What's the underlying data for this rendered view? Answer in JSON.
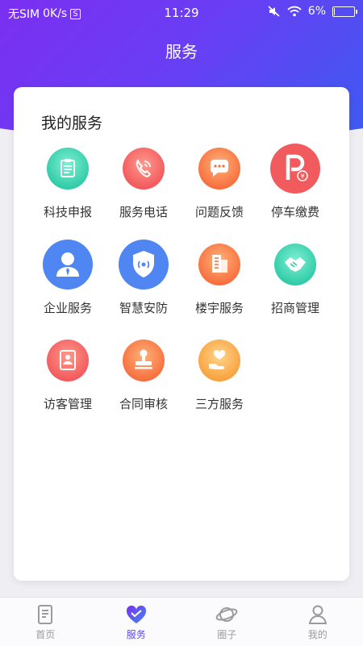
{
  "status_bar": {
    "carrier": "无SIM",
    "speed": "0K/s",
    "s_badge": "S",
    "time": "11:29",
    "battery_text": "6%",
    "battery_level": 0.06
  },
  "header": {
    "title": "服务"
  },
  "card": {
    "title": "我的服务",
    "items": [
      {
        "label": "科技申报",
        "icon": "clipboard-icon"
      },
      {
        "label": "服务电话",
        "icon": "phone-icon"
      },
      {
        "label": "问题反馈",
        "icon": "chat-bubble-icon"
      },
      {
        "label": "停车缴费",
        "icon": "parking-icon"
      },
      {
        "label": "企业服务",
        "icon": "person-icon"
      },
      {
        "label": "智慧安防",
        "icon": "shield-icon"
      },
      {
        "label": "楼宇服务",
        "icon": "building-icon"
      },
      {
        "label": "招商管理",
        "icon": "handshake-icon"
      },
      {
        "label": "访客管理",
        "icon": "visitor-badge-icon"
      },
      {
        "label": "合同审核",
        "icon": "stamp-icon"
      },
      {
        "label": "三方服务",
        "icon": "heart-hand-icon"
      }
    ]
  },
  "tabbar": {
    "tabs": [
      {
        "label": "首页",
        "icon": "home-doc-icon"
      },
      {
        "label": "服务",
        "icon": "heart-service-icon"
      },
      {
        "label": "圈子",
        "icon": "planet-icon"
      },
      {
        "label": "我的",
        "icon": "profile-icon"
      }
    ],
    "active_index": 1
  },
  "colors": {
    "header_gradient_start": "#7b2ff0",
    "header_gradient_end": "#3d5bf0",
    "active_tab": "#5b4bf0"
  }
}
